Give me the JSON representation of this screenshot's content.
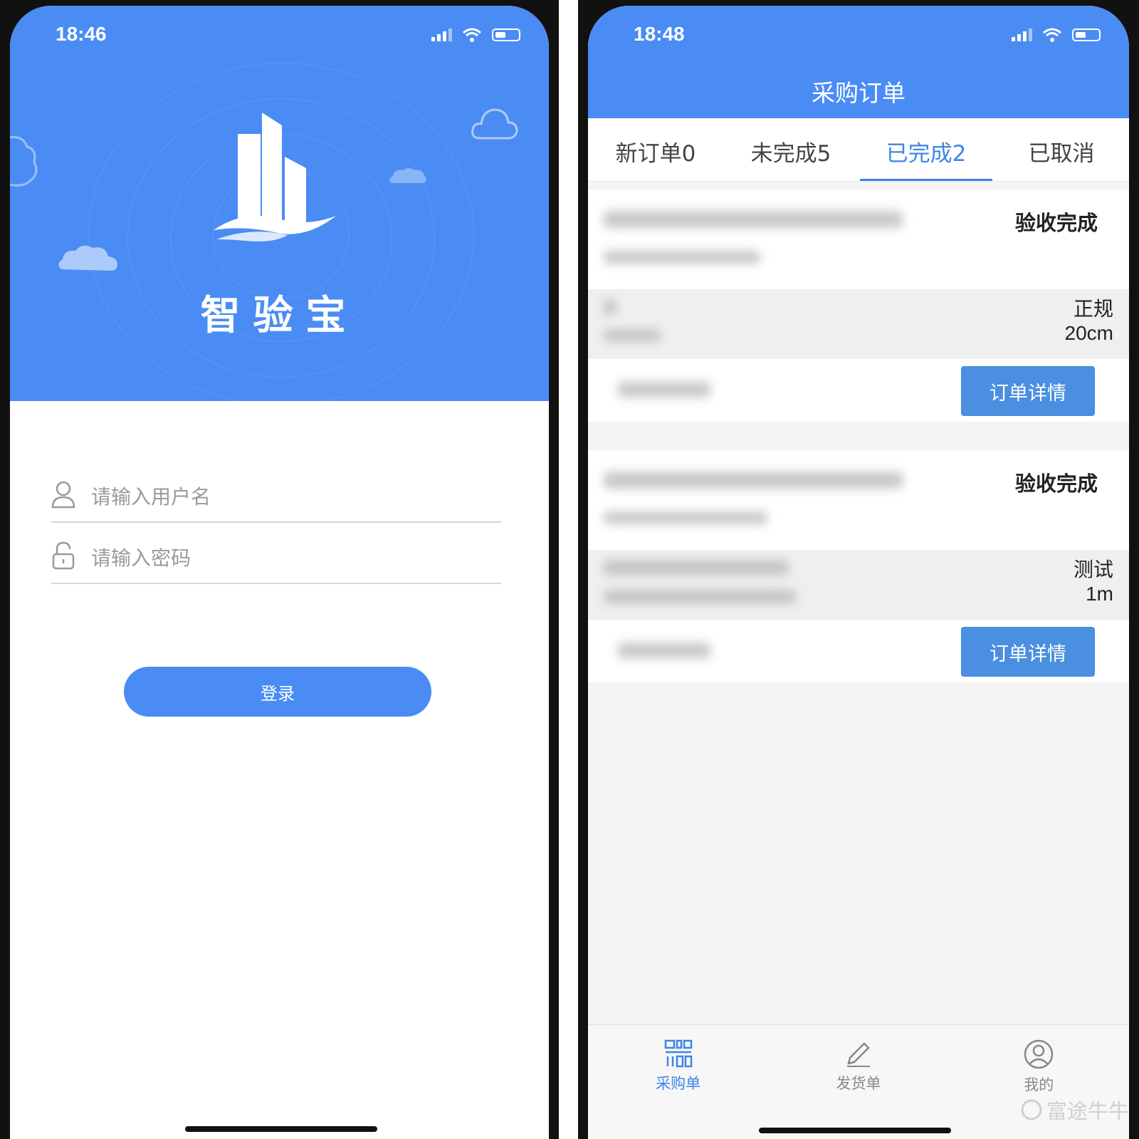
{
  "login": {
    "time": "18:46",
    "app_name": "智验宝",
    "username_placeholder": "请输入用户名",
    "password_placeholder": "请输入密码",
    "login_label": "登录",
    "accent_color": "#4a8cf3"
  },
  "orders": {
    "time": "18:48",
    "title": "采购订单",
    "tabs": [
      {
        "label": "新订单0"
      },
      {
        "label": "未完成5"
      },
      {
        "label": "已完成2",
        "active": true
      },
      {
        "label": "已取消"
      }
    ],
    "cards": [
      {
        "status": "验收完成",
        "type": "正规",
        "size": "20cm",
        "button": "订单详情"
      },
      {
        "status": "验收完成",
        "type": "测试",
        "size": "1m",
        "button": "订单详情"
      }
    ],
    "tabbar": [
      {
        "label": "采购单",
        "icon": "purchase-order-icon",
        "active": true
      },
      {
        "label": "发货单",
        "icon": "pencil-icon"
      },
      {
        "label": "我的",
        "icon": "user-profile-icon"
      }
    ],
    "watermark": "富途牛牛"
  }
}
